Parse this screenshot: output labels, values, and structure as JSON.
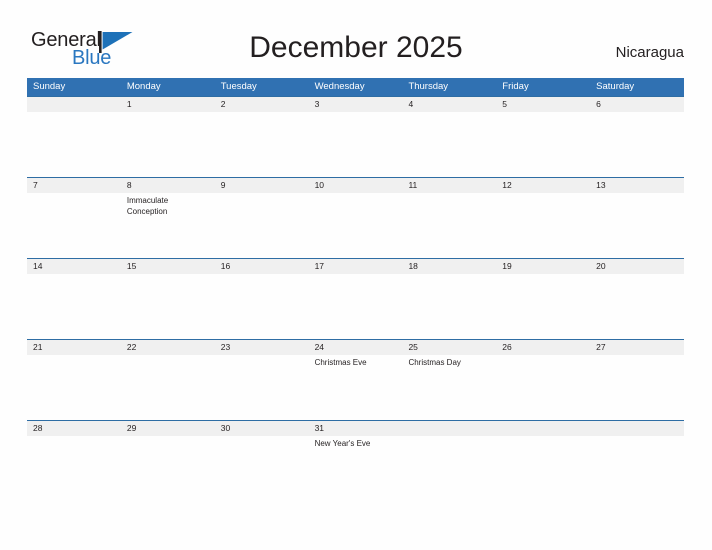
{
  "brand": {
    "name_part1": "General",
    "name_part2": "Blue",
    "flag_icon": "blue-triangle-flag-icon",
    "accent_color": "#2a77c0"
  },
  "header": {
    "title": "December 2025",
    "country": "Nicaragua"
  },
  "colors": {
    "header_blue": "#3071b2",
    "row_divider_blue": "#2e6da4",
    "date_band_gray": "#f0f0f0",
    "page_background": "#fefefe",
    "text": "#231f20"
  },
  "calendar": {
    "month": "December",
    "year": "2025",
    "weekdays": [
      "Sunday",
      "Monday",
      "Tuesday",
      "Wednesday",
      "Thursday",
      "Friday",
      "Saturday"
    ],
    "weeks": [
      [
        {
          "day": "",
          "event": ""
        },
        {
          "day": "1",
          "event": ""
        },
        {
          "day": "2",
          "event": ""
        },
        {
          "day": "3",
          "event": ""
        },
        {
          "day": "4",
          "event": ""
        },
        {
          "day": "5",
          "event": ""
        },
        {
          "day": "6",
          "event": ""
        }
      ],
      [
        {
          "day": "7",
          "event": ""
        },
        {
          "day": "8",
          "event": "Immaculate Conception"
        },
        {
          "day": "9",
          "event": ""
        },
        {
          "day": "10",
          "event": ""
        },
        {
          "day": "11",
          "event": ""
        },
        {
          "day": "12",
          "event": ""
        },
        {
          "day": "13",
          "event": ""
        }
      ],
      [
        {
          "day": "14",
          "event": ""
        },
        {
          "day": "15",
          "event": ""
        },
        {
          "day": "16",
          "event": ""
        },
        {
          "day": "17",
          "event": ""
        },
        {
          "day": "18",
          "event": ""
        },
        {
          "day": "19",
          "event": ""
        },
        {
          "day": "20",
          "event": ""
        }
      ],
      [
        {
          "day": "21",
          "event": ""
        },
        {
          "day": "22",
          "event": ""
        },
        {
          "day": "23",
          "event": ""
        },
        {
          "day": "24",
          "event": "Christmas Eve"
        },
        {
          "day": "25",
          "event": "Christmas Day"
        },
        {
          "day": "26",
          "event": ""
        },
        {
          "day": "27",
          "event": ""
        }
      ],
      [
        {
          "day": "28",
          "event": ""
        },
        {
          "day": "29",
          "event": ""
        },
        {
          "day": "30",
          "event": ""
        },
        {
          "day": "31",
          "event": "New Year's Eve"
        },
        {
          "day": "",
          "event": ""
        },
        {
          "day": "",
          "event": ""
        },
        {
          "day": "",
          "event": ""
        }
      ]
    ]
  }
}
